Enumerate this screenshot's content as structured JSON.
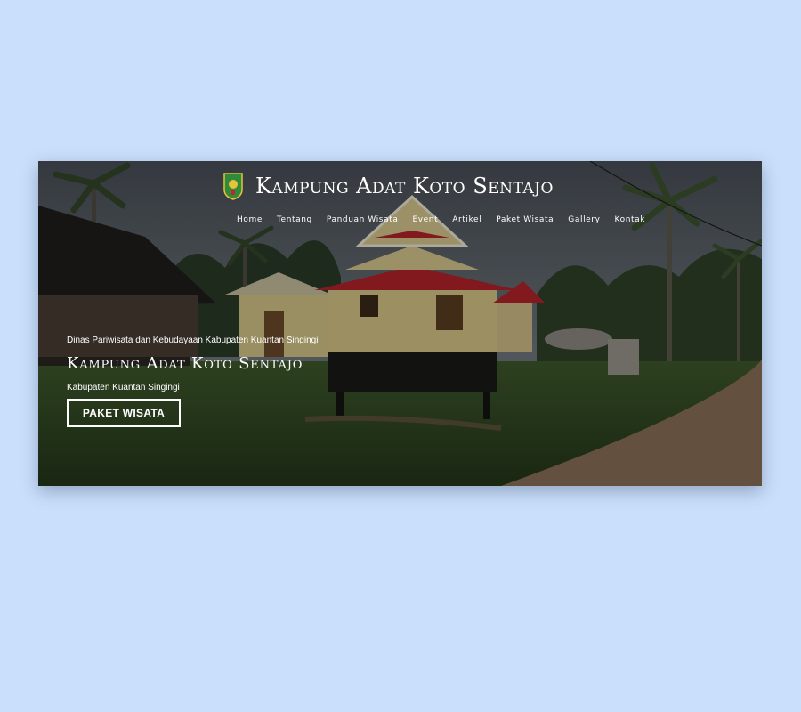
{
  "site": {
    "title": "Kampung Adat Koto Sentajo",
    "logo_icon": "regency-crest-icon"
  },
  "nav": {
    "items": [
      {
        "label": "Home"
      },
      {
        "label": "Tentang"
      },
      {
        "label": "Panduan Wisata"
      },
      {
        "label": "Event"
      },
      {
        "label": "Artikel"
      },
      {
        "label": "Paket Wisata"
      },
      {
        "label": "Gallery"
      },
      {
        "label": "Kontak"
      }
    ]
  },
  "hero": {
    "kicker": "Dinas Pariwisata dan Kebudayaan Kabupaten Kuantan Singingi",
    "title": "Kampung Adat Koto Sentajo",
    "subtitle": "Kabupaten Kuantan Singingi",
    "cta_label": "PAKET WISATA",
    "background": "traditional-stilt-house-photo"
  },
  "colors": {
    "page_background": "#c9dffb",
    "roof_red": "#b3232c",
    "wall_yellow": "#d9c88e"
  }
}
